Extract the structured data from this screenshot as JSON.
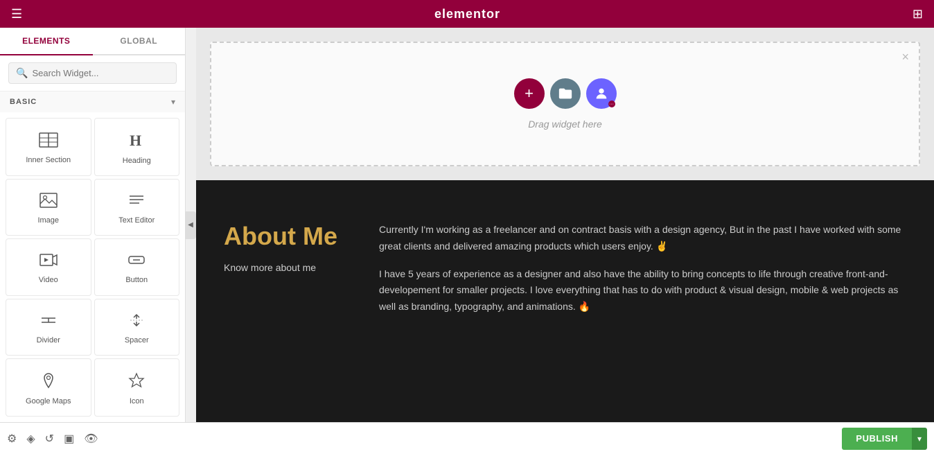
{
  "topBar": {
    "title": "elementor",
    "hamburgerLabel": "menu",
    "gridLabel": "apps"
  },
  "sidebar": {
    "tabs": [
      {
        "label": "ELEMENTS",
        "active": true
      },
      {
        "label": "GLOBAL",
        "active": false
      }
    ],
    "search": {
      "placeholder": "Search Widget..."
    },
    "section": {
      "label": "BASIC"
    },
    "widgets": [
      {
        "id": "inner-section",
        "label": "Inner Section",
        "icon": "inner-section-icon"
      },
      {
        "id": "heading",
        "label": "Heading",
        "icon": "heading-icon"
      },
      {
        "id": "image",
        "label": "Image",
        "icon": "image-icon"
      },
      {
        "id": "text-editor",
        "label": "Text Editor",
        "icon": "text-editor-icon"
      },
      {
        "id": "video",
        "label": "Video",
        "icon": "video-icon"
      },
      {
        "id": "button",
        "label": "Button",
        "icon": "button-icon"
      },
      {
        "id": "divider",
        "label": "Divider",
        "icon": "divider-icon"
      },
      {
        "id": "spacer",
        "label": "Spacer",
        "icon": "spacer-icon"
      },
      {
        "id": "google-maps",
        "label": "Google Maps",
        "icon": "maps-icon"
      },
      {
        "id": "icon",
        "label": "Icon",
        "icon": "icon-icon"
      }
    ]
  },
  "canvas": {
    "dropZone": {
      "dragText": "Drag widget here",
      "closeLabel": "×",
      "addBtn": "+",
      "folderBtn": "🗂",
      "avatarBtn": "👤"
    },
    "aboutSection": {
      "title": "About Me",
      "link": "Know more about me",
      "paragraph1": "Currently I'm working as a freelancer and on contract basis with a design agency, But in the past I have worked with some great clients and delivered amazing products which users enjoy. ✌",
      "paragraph2": "I have 5 years of experience as a designer and also have the ability to bring concepts to life through creative front-and-developement for smaller projects. I love everything that has to do with product & visual design, mobile & web projects as well as branding, typography, and animations. 🔥"
    }
  },
  "bottomBar": {
    "icons": [
      "settings",
      "layers",
      "history",
      "responsive",
      "preview"
    ],
    "publishBtn": "PUBLISH",
    "publishArrow": "▾"
  },
  "colors": {
    "brand": "#92003b",
    "publishGreen": "#4CAF50",
    "publishDarkGreen": "#388E3C",
    "folderGray": "#607d8b",
    "avatarPurple": "#6c63ff"
  }
}
